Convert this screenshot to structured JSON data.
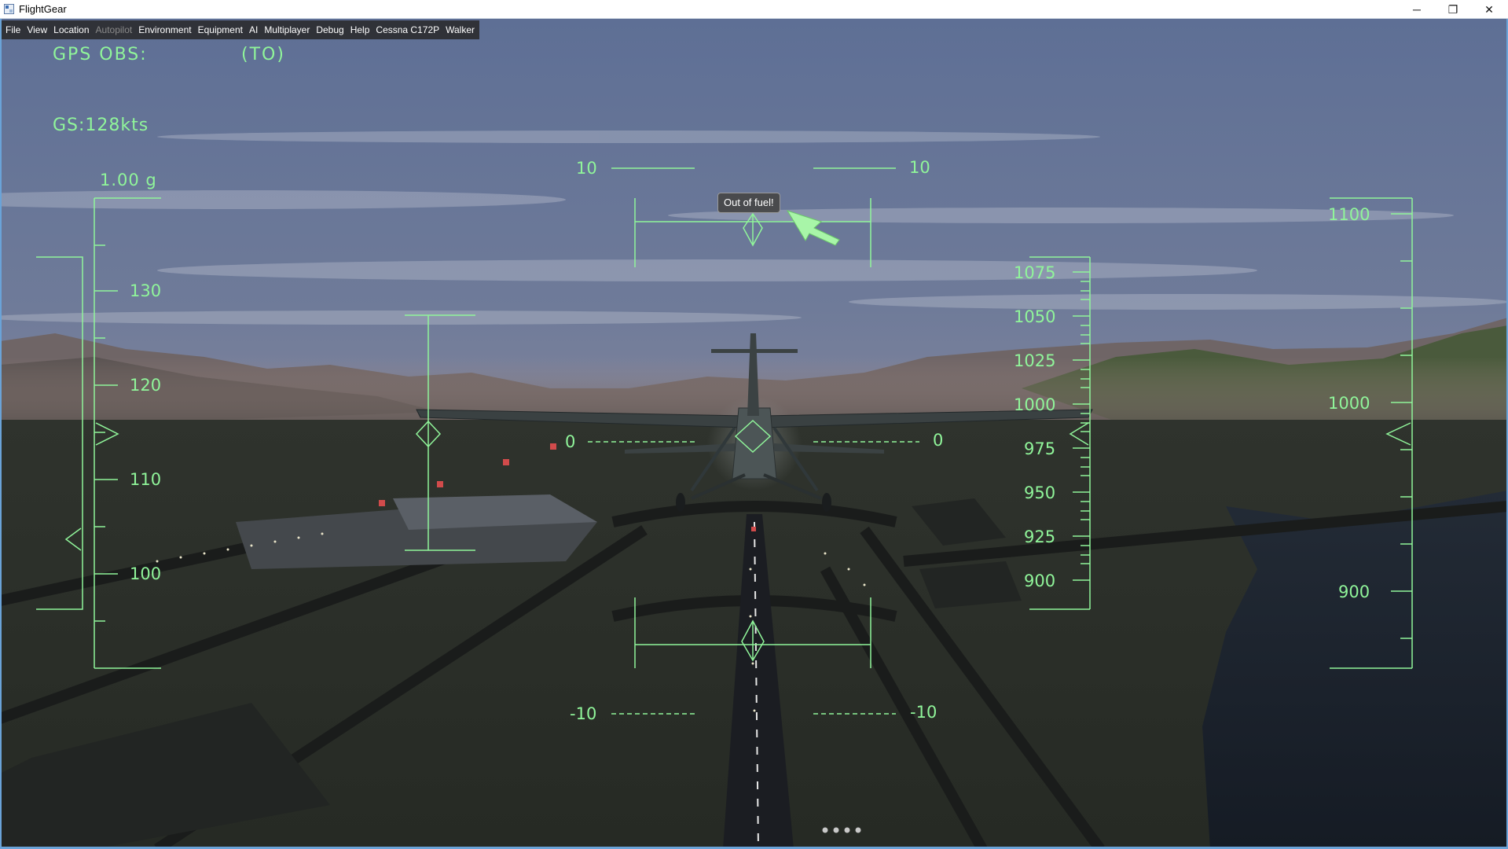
{
  "window": {
    "title": "FlightGear",
    "controls": {
      "minimize": "─",
      "restore": "❐",
      "close": "✕"
    }
  },
  "menu": [
    {
      "label": "File",
      "enabled": true
    },
    {
      "label": "View",
      "enabled": true
    },
    {
      "label": "Location",
      "enabled": true
    },
    {
      "label": "Autopilot",
      "enabled": false
    },
    {
      "label": "Environment",
      "enabled": true
    },
    {
      "label": "Equipment",
      "enabled": true
    },
    {
      "label": "AI",
      "enabled": true
    },
    {
      "label": "Multiplayer",
      "enabled": true
    },
    {
      "label": "Debug",
      "enabled": true
    },
    {
      "label": "Help",
      "enabled": true
    },
    {
      "label": "Cessna C172P",
      "enabled": true
    },
    {
      "label": "Walker",
      "enabled": true
    }
  ],
  "hud": {
    "color": "#90f59a",
    "gps_obs_label": "GPS OBS:",
    "gps_obs_flag": "(TO)",
    "ground_speed": "GS:128kts",
    "g_load": "1.00 g",
    "speed_tape": {
      "labels": [
        "130",
        "120",
        "110",
        "100"
      ]
    },
    "pitch_ladder": {
      "top": {
        "left": "10",
        "right": "10"
      },
      "horizon": {
        "left": "0",
        "right": "0"
      },
      "bottom": {
        "left": "-10",
        "right": "-10"
      }
    },
    "altitude_tape": {
      "labels": [
        "1075",
        "1050",
        "1025",
        "1000",
        "975",
        "950",
        "925",
        "900"
      ]
    },
    "vsi_tape": {
      "labels": [
        "1100",
        "1000",
        "900"
      ]
    }
  },
  "message": {
    "text": "Out of fuel!"
  },
  "icons": {
    "app": "flightgear-app-icon",
    "pointer": "mouse-pointer-icon",
    "loading": "loading-dots-icon"
  }
}
